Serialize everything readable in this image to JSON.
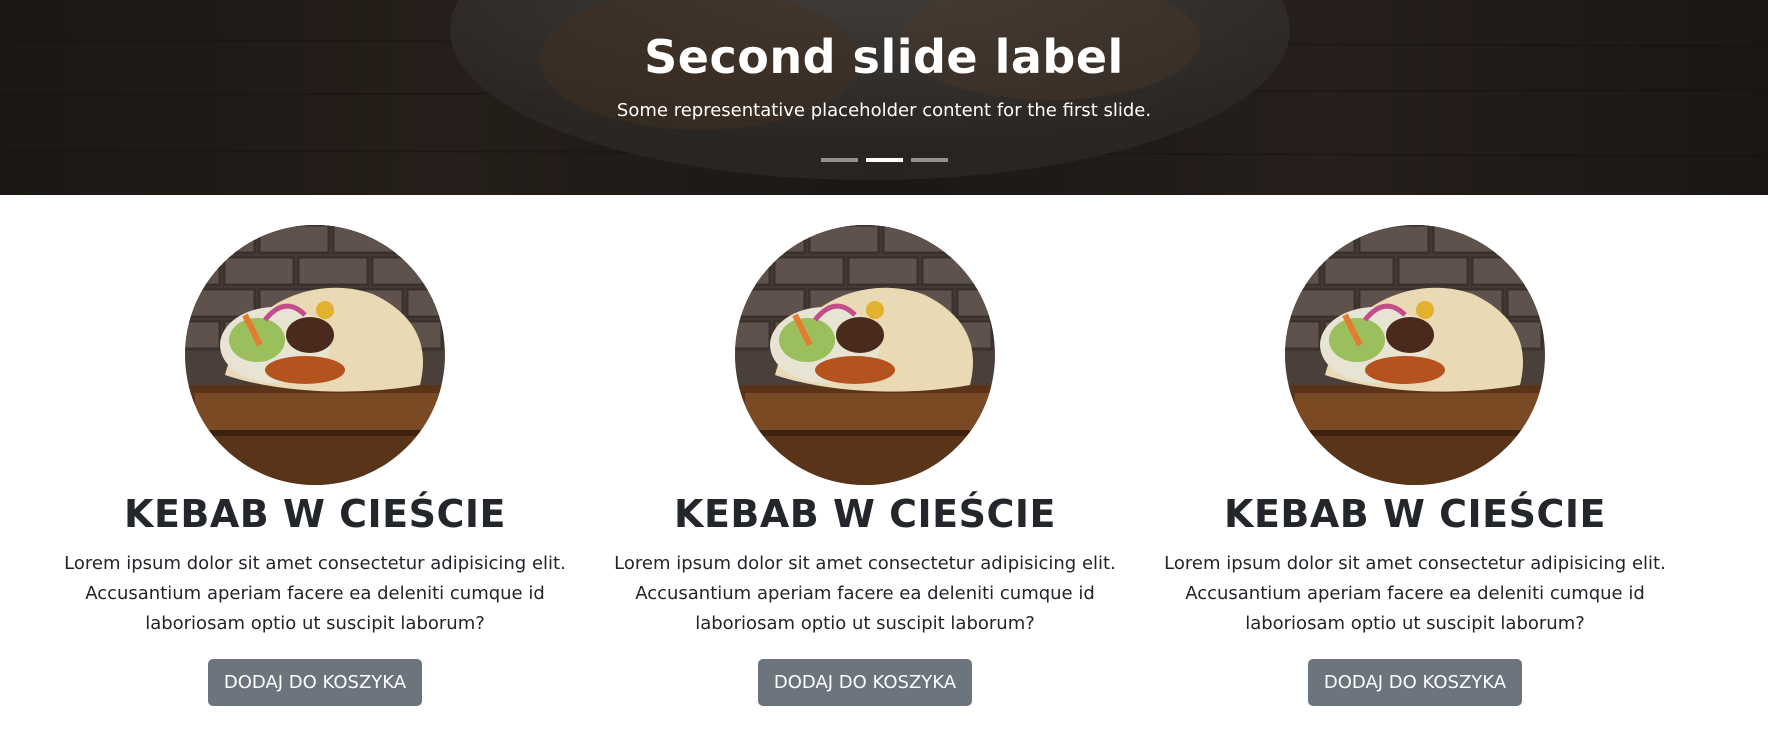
{
  "carousel": {
    "title": "Second slide label",
    "text": "Some representative placeholder content for the first slide.",
    "indicators": [
      {
        "label": "Slide 1",
        "active": false
      },
      {
        "label": "Slide 2",
        "active": true
      },
      {
        "label": "Slide 3",
        "active": false
      }
    ]
  },
  "products": [
    {
      "image": "kebab-wrap-photo",
      "title": "KEBAB W CIEŚCIE",
      "description": "Lorem ipsum dolor sit amet consectetur adipisicing elit. Accusantium aperiam facere ea deleniti cumque id laboriosam optio ut suscipit laborum?",
      "button_label": "DODAJ DO KOSZYKA"
    },
    {
      "image": "kebab-wrap-photo",
      "title": "KEBAB W CIEŚCIE",
      "description": "Lorem ipsum dolor sit amet consectetur adipisicing elit. Accusantium aperiam facere ea deleniti cumque id laboriosam optio ut suscipit laborum?",
      "button_label": "DODAJ DO KOSZYKA"
    },
    {
      "image": "kebab-wrap-photo",
      "title": "KEBAB W CIEŚCIE",
      "description": "Lorem ipsum dolor sit amet consectetur adipisicing elit. Accusantium aperiam facere ea deleniti cumque id laboriosam optio ut suscipit laborum?",
      "button_label": "DODAJ DO KOSZYKA"
    }
  ],
  "colors": {
    "button_bg": "#6c757d",
    "button_text": "#ffffff",
    "heading": "#23272b",
    "hero_text": "#ffffff"
  }
}
